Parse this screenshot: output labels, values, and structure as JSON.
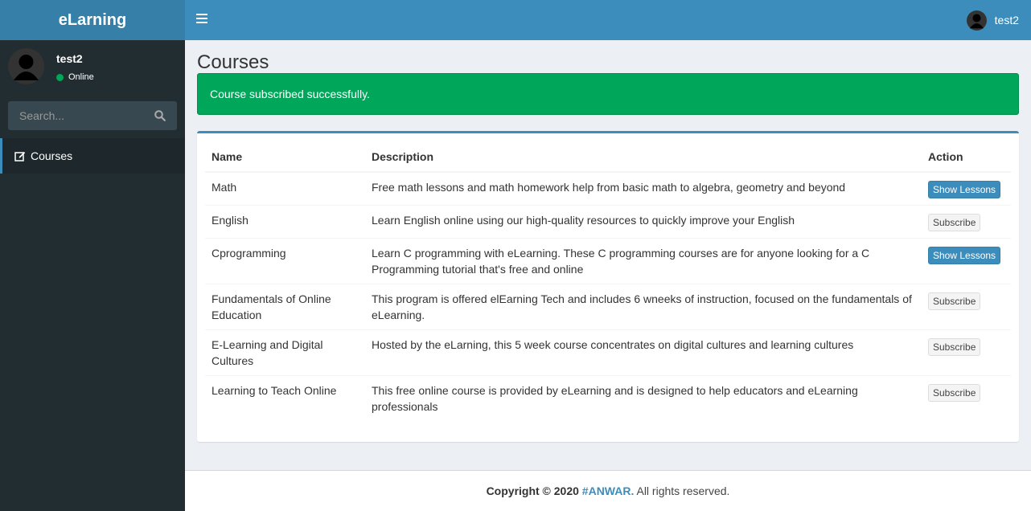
{
  "app": {
    "name": "eLarning"
  },
  "header": {
    "user_name": "test2"
  },
  "sidebar": {
    "user": {
      "name": "test2",
      "status": "Online"
    },
    "search_placeholder": "Search...",
    "menu": [
      {
        "label": "Courses",
        "icon": "edit-icon"
      }
    ]
  },
  "page": {
    "title": "Courses"
  },
  "alert": {
    "message": "Course subscribed successfully.",
    "color": "#00a65a"
  },
  "table": {
    "headers": {
      "name": "Name",
      "description": "Description",
      "action": "Action"
    },
    "rows": [
      {
        "name": "Math",
        "description": "Free math lessons and math homework help from basic math to algebra, geometry and beyond",
        "action": "Show Lessons"
      },
      {
        "name": "English",
        "description": "Learn English online using our high-quality resources to quickly improve your English",
        "action": "Subscribe"
      },
      {
        "name": "Cprogramming",
        "description": "Learn C programming with eLearning. These C programming courses are for anyone looking for a C Programming tutorial that's free and online",
        "action": "Show Lessons"
      },
      {
        "name": "Fundamentals of Online Education",
        "description": "This program is offered elEarning Tech and includes 6 wneeks of instruction, focused on the fundamentals of eLearning.",
        "action": "Subscribe"
      },
      {
        "name": "E-Learning and Digital Cultures",
        "description": "Hosted by the eLarning, this 5 week course concentrates on digital cultures and learning cultures",
        "action": "Subscribe"
      },
      {
        "name": "Learning to Teach Online",
        "description": "This free online course is provided by eLearning and is designed to help educators and eLearning professionals",
        "action": "Subscribe"
      }
    ]
  },
  "footer": {
    "copyright": "Copyright © 2020",
    "author": "#ANWAR.",
    "rights": " All rights reserved."
  },
  "colors": {
    "header": "#3c8dbc",
    "logo": "#367fa9",
    "sidebar": "#222d32",
    "success": "#00a65a"
  }
}
